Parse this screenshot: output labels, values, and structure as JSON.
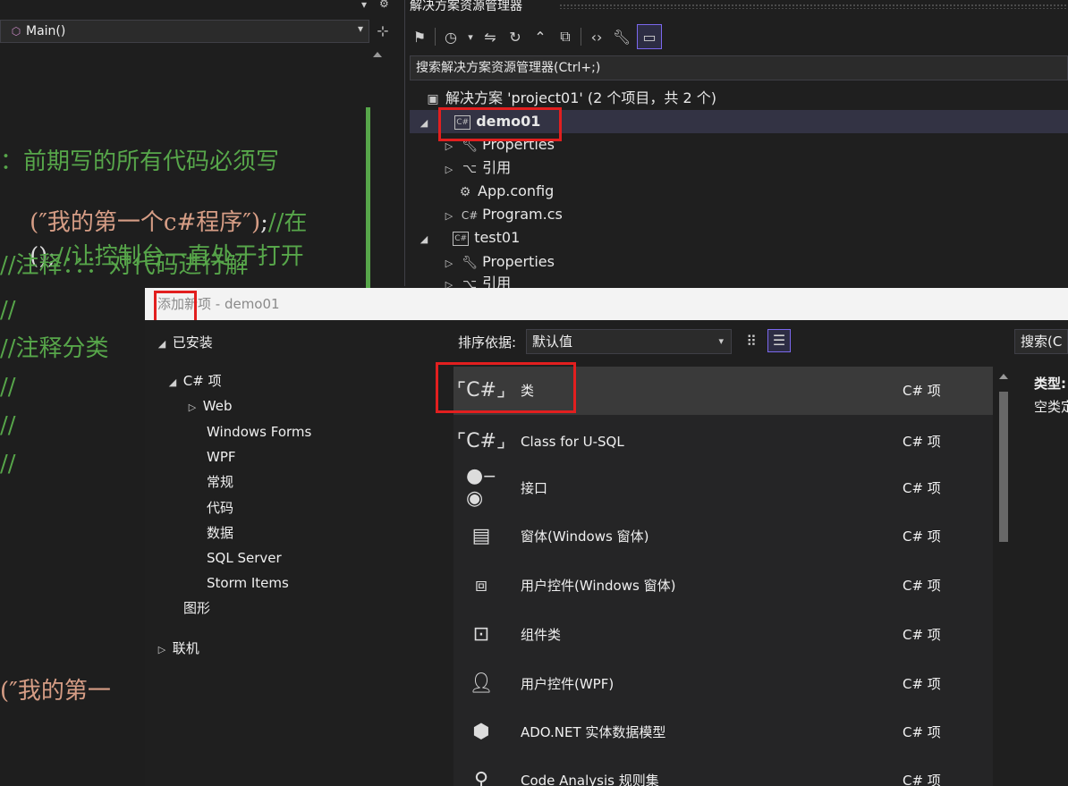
{
  "editor": {
    "nav_member": "Main()",
    "code_lines": [
      {
        "text": "：前期写的所有代码必须写",
        "color": "green"
      },
      {
        "text": "(″我的第一个c#程序″);//在",
        "color": "mixed"
      },
      {
        "text": "();//让控制台一直处于打开",
        "color": "mixed"
      },
      {
        "text": "//注释：：：对代码进行解",
        "color": "green"
      },
      {
        "text": "//",
        "color": "green"
      },
      {
        "text": "//注释分类",
        "color": "green"
      },
      {
        "text": "//",
        "color": "green"
      },
      {
        "text": "//",
        "color": "green"
      },
      {
        "text": "//",
        "color": "green"
      },
      {
        "text": "(″我的第一",
        "color": "orange"
      }
    ]
  },
  "solution_explorer": {
    "title": "解决方案资源管理器",
    "search_placeholder": "搜索解决方案资源管理器(Ctrl+;)",
    "tree": [
      {
        "label": "解决方案 'project01' (2 个项目，共 2 个)",
        "indent": 0
      },
      {
        "label": "demo01",
        "indent": 1,
        "bold": true,
        "selected": true
      },
      {
        "label": "Properties",
        "indent": 2
      },
      {
        "label": "引用",
        "indent": 2
      },
      {
        "label": "App.config",
        "indent": 2
      },
      {
        "label": "Program.cs",
        "indent": 2
      },
      {
        "label": "test01",
        "indent": 1
      },
      {
        "label": "Properties",
        "indent": 2
      },
      {
        "label": "引用",
        "indent": 2
      }
    ]
  },
  "dialog": {
    "title": "添加新项 - demo01",
    "categories": [
      {
        "label": "已安装",
        "level": 0,
        "expanded": true
      },
      {
        "label": "C# 项",
        "level": 1,
        "expanded": true
      },
      {
        "label": "Web",
        "level": 2,
        "collapsed": true
      },
      {
        "label": "Windows Forms",
        "level": 2
      },
      {
        "label": "WPF",
        "level": 2
      },
      {
        "label": "常规",
        "level": 2
      },
      {
        "label": "代码",
        "level": 2
      },
      {
        "label": "数据",
        "level": 2
      },
      {
        "label": "SQL Server",
        "level": 2
      },
      {
        "label": "Storm Items",
        "level": 2
      },
      {
        "label": "图形",
        "level": 1
      },
      {
        "label": "联机",
        "level": 0,
        "collapsed": true
      }
    ],
    "sort_label": "排序依据:",
    "sort_value": "默认值",
    "search_placeholder": "搜索(C",
    "templates": [
      {
        "name": "类",
        "lang": "C# 项",
        "icon": "class-icon",
        "selected": true
      },
      {
        "name": "Class for U-SQL",
        "lang": "C# 项",
        "icon": "usql-class-icon"
      },
      {
        "name": "接口",
        "lang": "C# 项",
        "icon": "interface-icon"
      },
      {
        "name": "窗体(Windows 窗体)",
        "lang": "C# 项",
        "icon": "form-icon"
      },
      {
        "name": "用户控件(Windows 窗体)",
        "lang": "C# 项",
        "icon": "user-control-icon"
      },
      {
        "name": "组件类",
        "lang": "C# 项",
        "icon": "component-icon"
      },
      {
        "name": "用户控件(WPF)",
        "lang": "C# 项",
        "icon": "wpf-user-control-icon"
      },
      {
        "name": "ADO.NET 实体数据模型",
        "lang": "C# 项",
        "icon": "ado-model-icon"
      },
      {
        "name": "Code Analysis 规则集",
        "lang": "C# 项",
        "icon": "ruleset-icon"
      }
    ],
    "details": {
      "type_label": "类型:",
      "desc": "空类定"
    }
  },
  "colors": {
    "accent": "#7b68ee",
    "highlight": "#e21f1f",
    "comment": "#57a64a",
    "string": "#d69d85"
  }
}
